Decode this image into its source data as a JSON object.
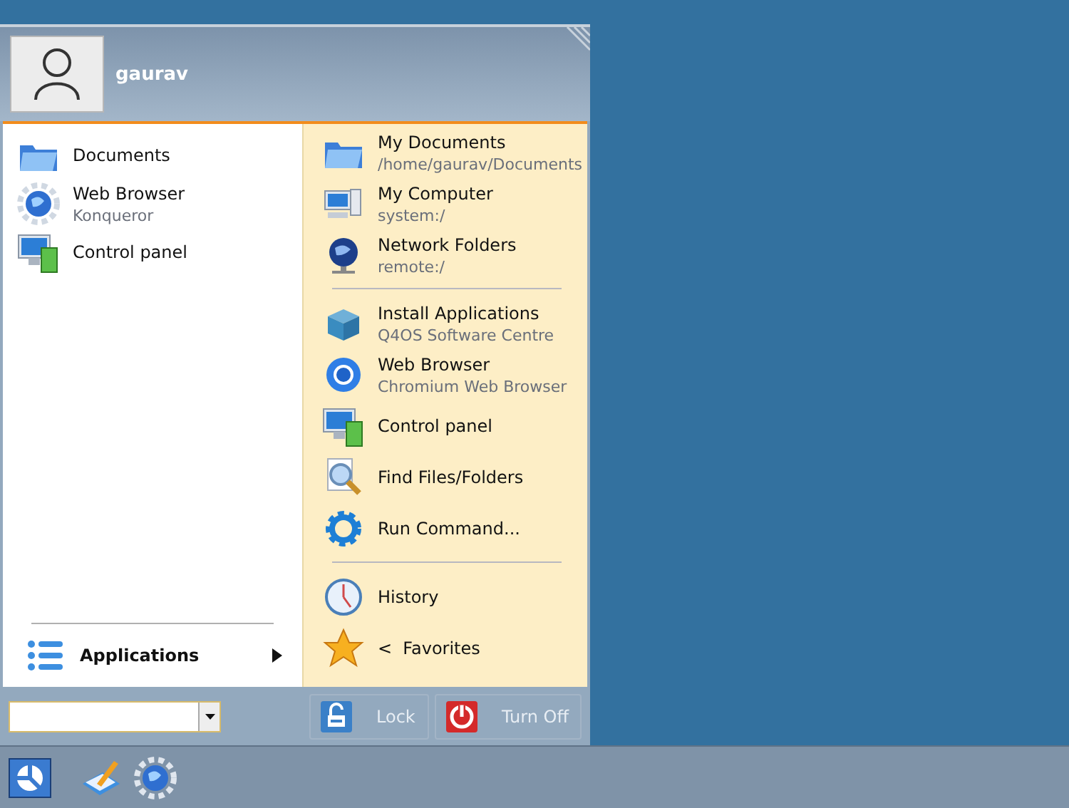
{
  "user": {
    "name": "gaurav"
  },
  "favorites": [
    {
      "kind": "entry",
      "title": "Documents"
    },
    {
      "kind": "entry",
      "title": "Web Browser",
      "subtitle": "Konqueror"
    },
    {
      "kind": "entry",
      "title": "Control panel"
    }
  ],
  "applications": {
    "label": "Applications"
  },
  "places": [
    {
      "kind": "entry",
      "title": "My Documents",
      "subtitle": "/home/gaurav/Documents"
    },
    {
      "kind": "entry",
      "title": "My Computer",
      "subtitle": "system:/"
    },
    {
      "kind": "entry",
      "title": "Network Folders",
      "subtitle": "remote:/"
    },
    {
      "kind": "separator"
    },
    {
      "kind": "entry",
      "title": "Install Applications",
      "subtitle": "Q4OS Software Centre"
    },
    {
      "kind": "entry",
      "title": "Web Browser",
      "subtitle": "Chromium Web Browser"
    },
    {
      "kind": "entry",
      "title": "Control panel"
    },
    {
      "kind": "entry",
      "title": "Find Files/Folders"
    },
    {
      "kind": "entry",
      "title": "Run Command..."
    },
    {
      "kind": "separator"
    },
    {
      "kind": "entry",
      "title": "History"
    },
    {
      "kind": "entry",
      "title": "<  Favorites"
    }
  ],
  "buttons": [
    {
      "label": "Lock"
    },
    {
      "label": "Turn Off"
    }
  ]
}
